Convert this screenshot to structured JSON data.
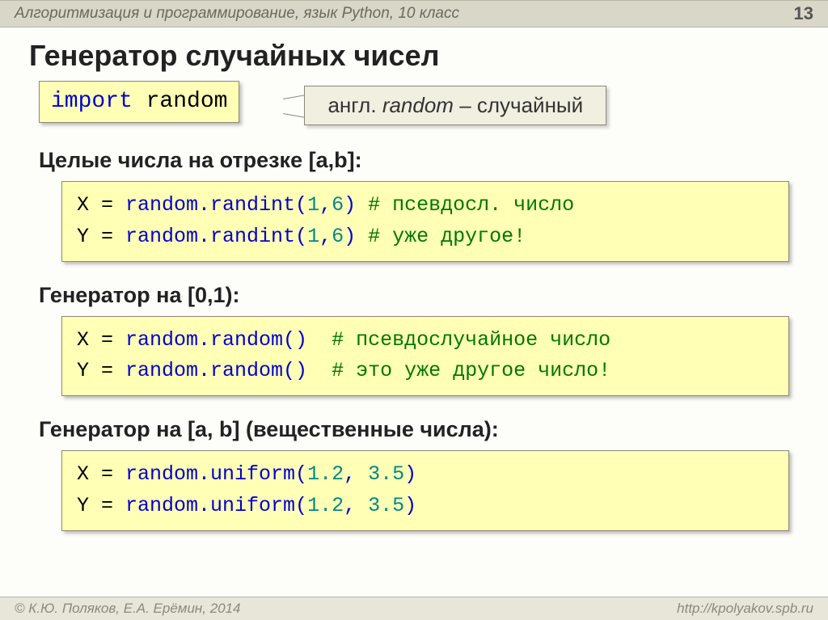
{
  "header": {
    "course": "Алгоритмизация и программирование, язык Python, 10 класс",
    "page": "13"
  },
  "title": "Генератор случайных чисел",
  "import_box": {
    "kw": "import",
    "mod": " random"
  },
  "callout": {
    "prefix": "англ. ",
    "word": "random",
    "suffix": " – случайный"
  },
  "section1": {
    "heading": "Целые числа на отрезке [a,b]:",
    "line1_a": "X = ",
    "line1_b": "random.randint(",
    "line1_c": "1",
    "line1_d": ",",
    "line1_e": "6",
    "line1_f": ")",
    "line1_g": " # псевдосл. число",
    "line2_a": "Y = ",
    "line2_b": "random.randint(",
    "line2_c": "1",
    "line2_d": ",",
    "line2_e": "6",
    "line2_f": ")",
    "line2_g": " # уже другое!"
  },
  "section2": {
    "heading": "Генератор на [0,1):",
    "line1_a": "X = ",
    "line1_b": "random.random()",
    "line1_g": "  # псевдослучайное число",
    "line2_a": "Y = ",
    "line2_b": "random.random()",
    "line2_g": "  # это уже другое число!"
  },
  "section3": {
    "heading": "Генератор на [a, b] (вещественные числа):",
    "line1_a": "X = ",
    "line1_b": "random.uniform(",
    "line1_c": "1.2",
    "line1_d": ", ",
    "line1_e": "3.5",
    "line1_f": ")",
    "line2_a": "Y = ",
    "line2_b": "random.uniform(",
    "line2_c": "1.2",
    "line2_d": ", ",
    "line2_e": "3.5",
    "line2_f": ")"
  },
  "footer": {
    "left": "© К.Ю. Поляков, Е.А. Ерёмин, 2014",
    "right": "http://kpolyakov.spb.ru"
  }
}
